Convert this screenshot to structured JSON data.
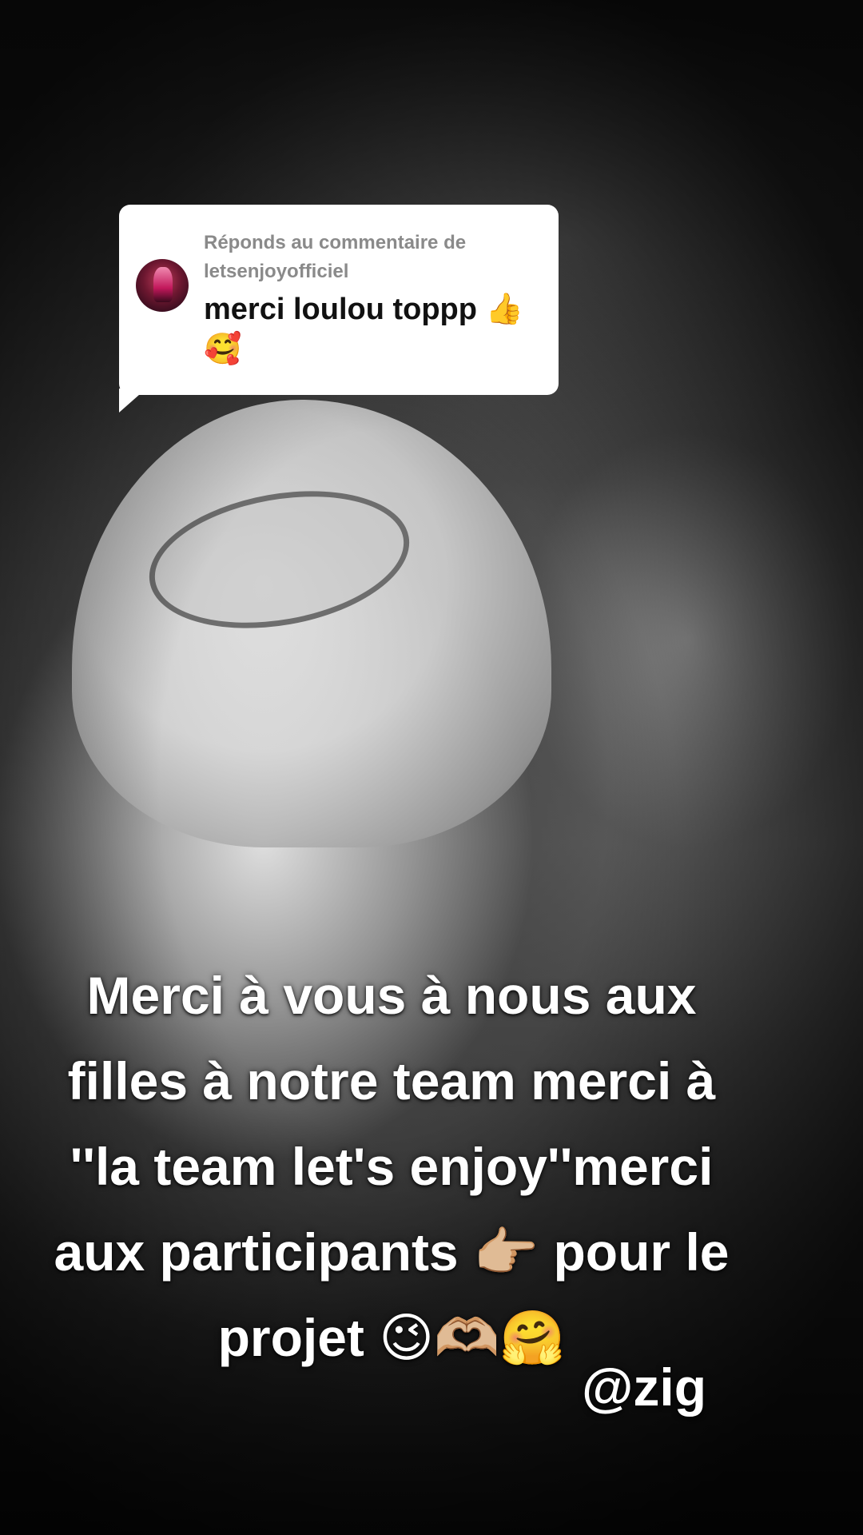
{
  "reply": {
    "label": "Réponds au commentaire de letsenjoyofficiel",
    "comment": "merci loulou toppp 👍🥰"
  },
  "caption": {
    "lines": [
      "Merci à vous à nous aux",
      "filles à notre team merci à",
      "''la team let's enjoy''merci",
      "aux participants 👉🏼 pour le",
      "projet 😉🫶🏼🤗"
    ]
  },
  "mention": "@zig"
}
